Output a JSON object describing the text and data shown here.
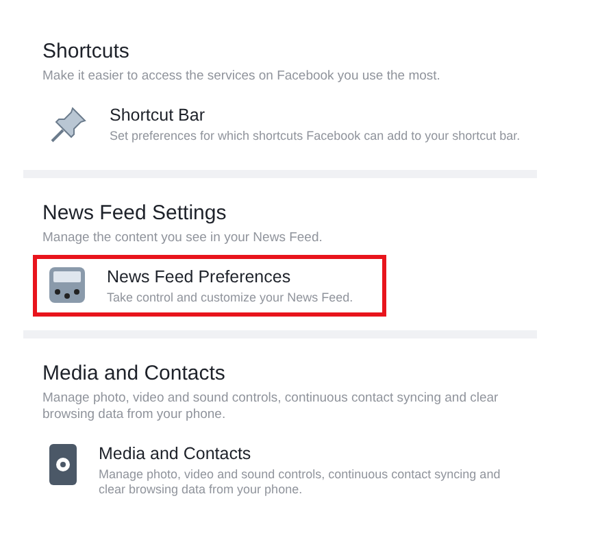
{
  "sections": [
    {
      "title": "Shortcuts",
      "description": "Make it easier to access the services on Facebook you use the most.",
      "items": [
        {
          "kind": "pin",
          "title": "Shortcut Bar",
          "description": "Set preferences for which shortcuts Facebook can add to your shortcut bar.",
          "highlighted": false
        }
      ]
    },
    {
      "title": "News Feed Settings",
      "description": "Manage the content you see in your News Feed.",
      "items": [
        {
          "kind": "feed",
          "title": "News Feed Preferences",
          "description": "Take control and customize your News Feed.",
          "highlighted": true
        }
      ]
    },
    {
      "title": "Media and Contacts",
      "description": "Manage photo, video and sound controls, continuous contact syncing and clear browsing data from your phone.",
      "items": [
        {
          "kind": "phone",
          "title": "Media and Contacts",
          "description": "Manage photo, video and sound controls, continuous contact syncing and clear browsing data from your phone.",
          "highlighted": false
        }
      ]
    }
  ]
}
